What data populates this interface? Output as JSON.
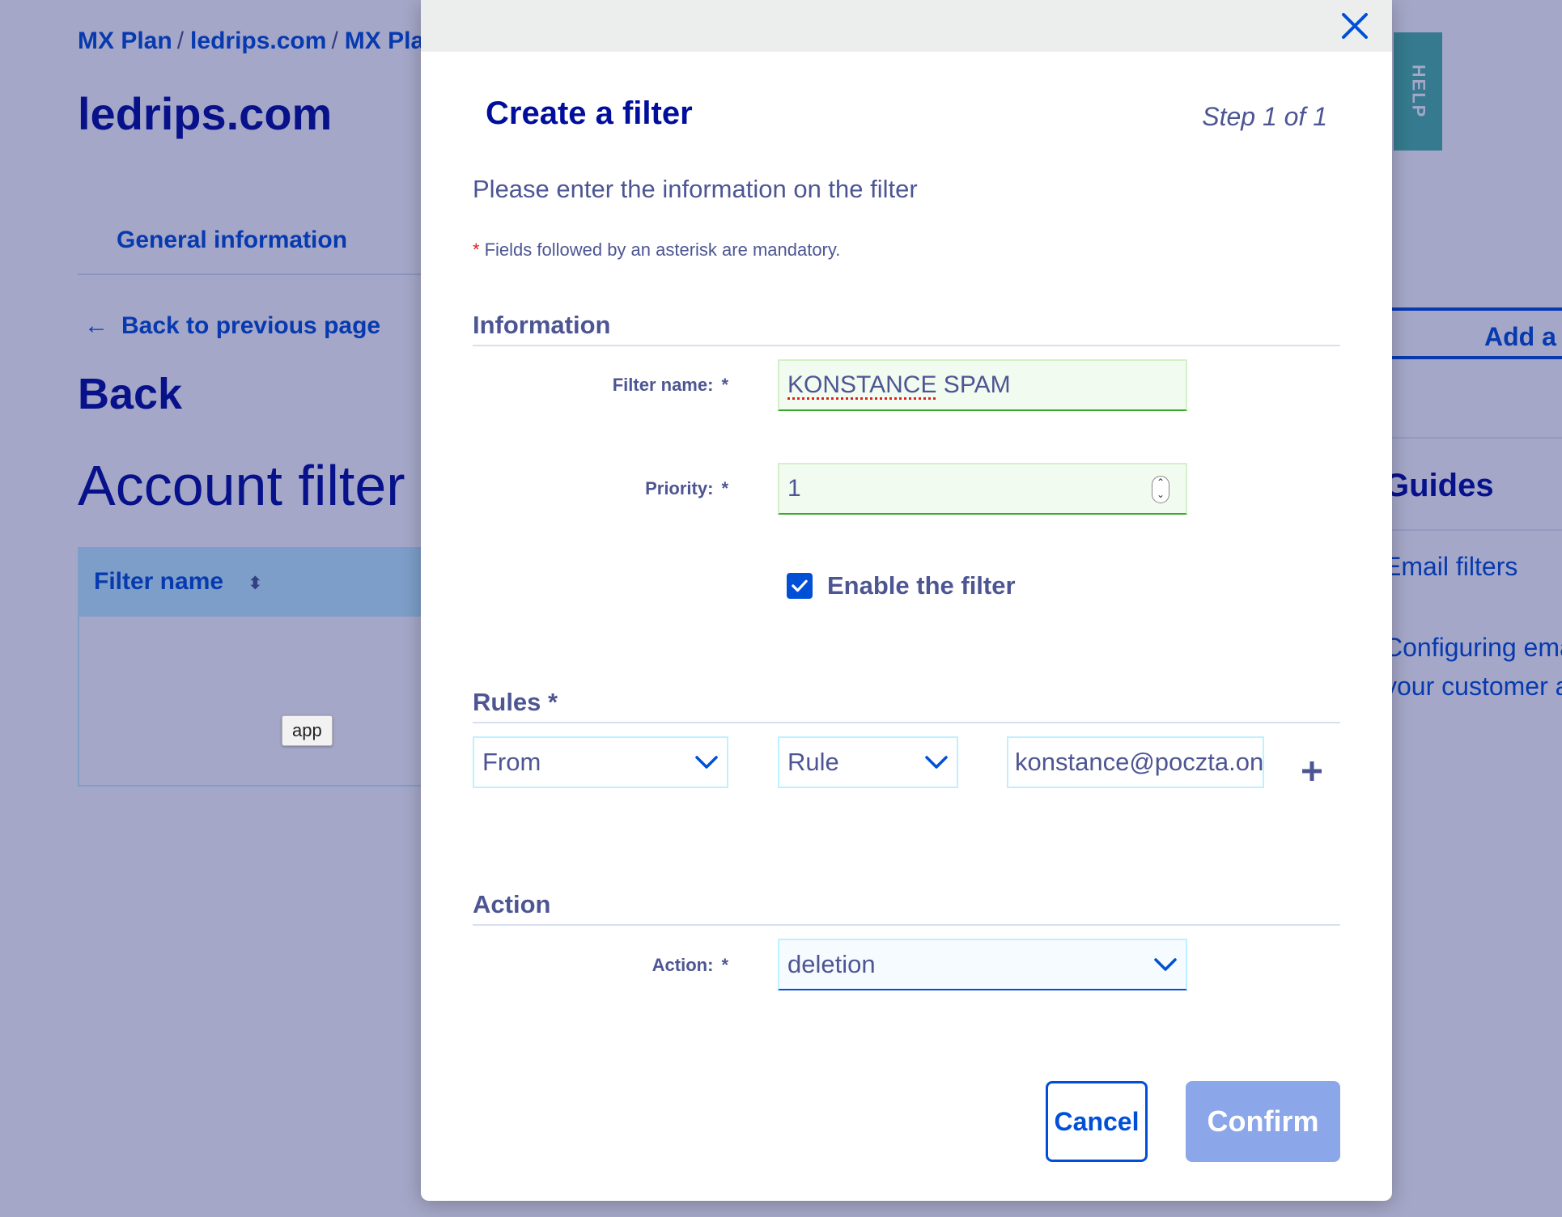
{
  "background": {
    "breadcrumb": [
      "MX Plan",
      "ledrips.com",
      "MX Pla"
    ],
    "breadcrumb_sep": "/",
    "domain_title": "ledrips.com",
    "tab_general": "General information",
    "back_link": "Back to previous page",
    "back_heading": "Back",
    "page_heading": "Account filter r",
    "table_header": "Filter name",
    "tooltip": "app",
    "add_button": "Add a f",
    "guides": {
      "title": "Guides",
      "item1": "Email filters",
      "item2_line1": "Configuring ema",
      "item2_line2": "your customer a"
    },
    "help_tab": "HELP"
  },
  "modal": {
    "title": "Create a filter",
    "step": "Step 1 of 1",
    "intro": "Please enter the information on the filter",
    "mandatory_note": "Fields followed by an asterisk are mandatory.",
    "asterisk": "*",
    "information_section": "Information",
    "filter_name_label": "Filter name:",
    "filter_name_value": "KONSTANCE",
    "filter_name_value_2": " SPAM",
    "priority_label": "Priority:",
    "priority_value": "1",
    "enable_label": "Enable the filter",
    "enable_checked": true,
    "rules_section": "Rules *",
    "rule_header": "From",
    "rule_operator": "Rule",
    "rule_value": "konstance@poczta.on",
    "action_section": "Action",
    "action_label": "Action:",
    "action_value": "deletion",
    "cancel": "Cancel",
    "confirm": "Confirm"
  },
  "colors": {
    "primary": "#0050d7",
    "heading": "#000e9c",
    "text": "#4d5693",
    "help": "#4bb7a2",
    "confirm_disabled": "#8ba6e9"
  }
}
